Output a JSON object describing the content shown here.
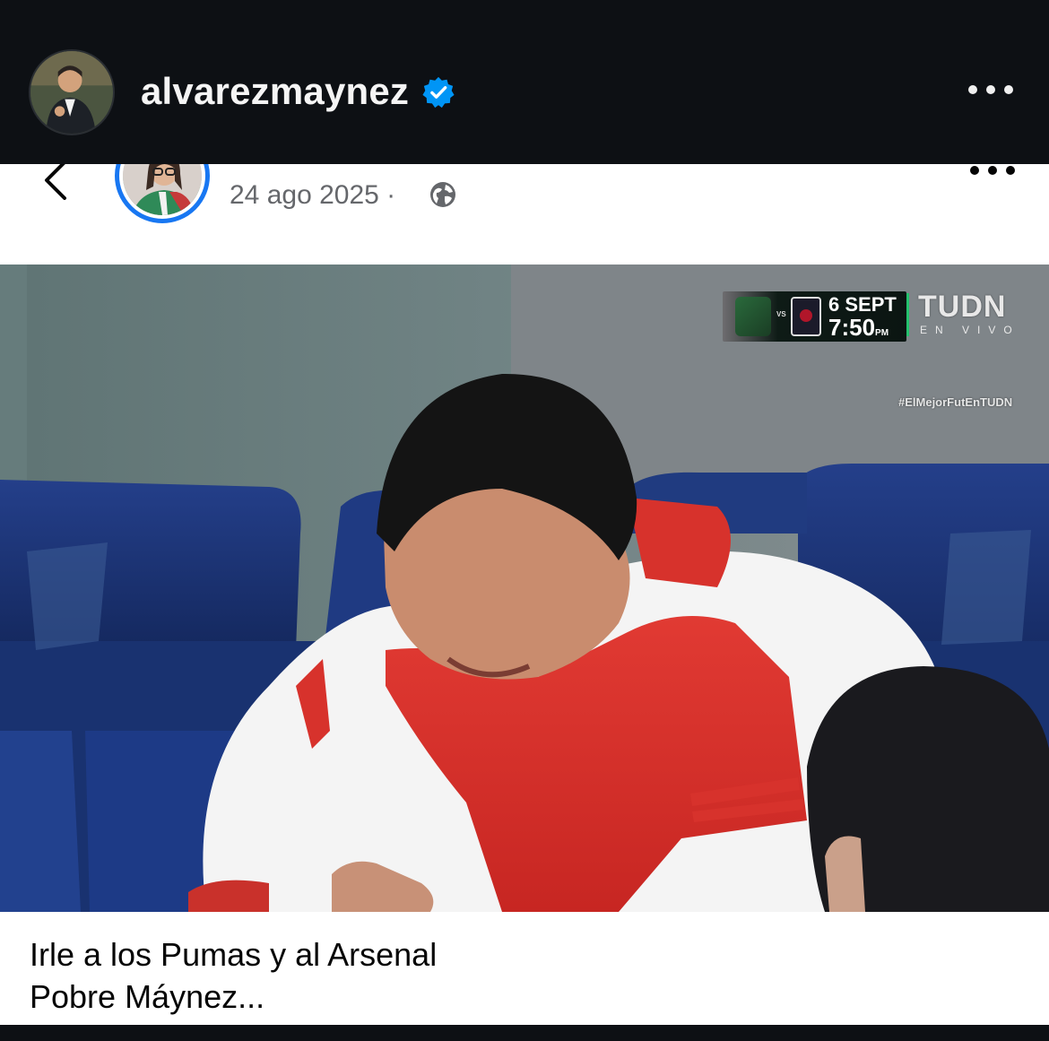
{
  "instagram_header": {
    "username": "alvarezmaynez",
    "verified_icon": "verified-badge-icon",
    "more_icon": "more-horizontal-icon"
  },
  "facebook_post": {
    "back_icon": "chevron-left-icon",
    "date": "24 ago 2025 ·",
    "privacy_icon": "globe-icon",
    "more_icon": "more-horizontal-icon",
    "video_overlay": {
      "broadcast_date": "6 SEPT",
      "broadcast_time": "7:50",
      "broadcast_time_suffix": "PM",
      "vs_label": "VS",
      "brand": "TUDN",
      "live_label": "EN VIVO",
      "hashtag": "#ElMejorFutEnTUDN"
    },
    "caption_line_1": "Irle a los Pumas y al Arsenal",
    "caption_line_2": "Pobre Máynez..."
  },
  "colors": {
    "header_background": "#0d1014",
    "verified_blue": "#0095f6",
    "facebook_blue": "#1877f2",
    "arsenal_red": "#d92b2b",
    "tudn_green": "#24c16d"
  }
}
